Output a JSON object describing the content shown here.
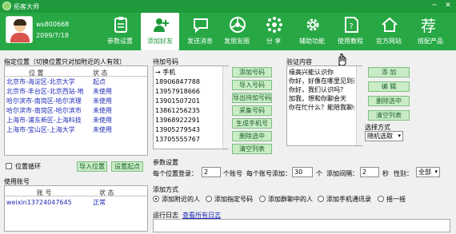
{
  "window": {
    "title": "拓客大师",
    "controls": [
      "─",
      "✕"
    ]
  },
  "account": {
    "name": "ws800668",
    "date": "2099/7/18"
  },
  "nav": [
    {
      "label": "参数设置",
      "icon": "clipboard-icon"
    },
    {
      "label": "添加好友",
      "icon": "add-user-icon"
    },
    {
      "label": "发送消息",
      "icon": "chat-icon"
    },
    {
      "label": "发朋友圈",
      "icon": "moments-icon"
    },
    {
      "label": "分  享",
      "icon": "share-icon"
    },
    {
      "label": "辅助功能",
      "icon": "gear-icon"
    },
    {
      "label": "使用教程",
      "icon": "help-icon"
    },
    {
      "label": "官方网站",
      "icon": "home-icon"
    },
    {
      "label": "搭配产品",
      "icon": "recommend-icon"
    }
  ],
  "nav_recommend_glyph": "荐",
  "location": {
    "title": "指定位置（切换位置只对加附近的人有效）",
    "headers": [
      "位    置",
      "状    态"
    ],
    "rows": [
      {
        "place": "北京市-海淀区-北京大学",
        "status": "起点"
      },
      {
        "place": "北京市-丰台区-北京西站-地",
        "status": "未使用"
      },
      {
        "place": "哈尔滨市-南岗区-哈尔滨理",
        "status": "未使用"
      },
      {
        "place": "哈尔滨市-南岗区-哈尔滨市",
        "status": "未使用"
      },
      {
        "place": "上海市-浦东新区-上海科技",
        "status": "未使用"
      },
      {
        "place": "上海市-宝山区-上海大学",
        "status": "未使用"
      }
    ],
    "loop_label": "位置循环",
    "import_label": "导入位置",
    "set_start_label": "设置起点"
  },
  "accounts_used": {
    "title": "使用账号",
    "headers": [
      "账    号",
      "状    态"
    ],
    "rows": [
      {
        "account": "weixin13724047645",
        "status": "正常"
      }
    ]
  },
  "pending": {
    "title": "待加号码",
    "items": [
      "→ 手机",
      "18906847788",
      "13957918666",
      "13901507201",
      "13861256235",
      "13968922291",
      "13905279543",
      "13705555767"
    ],
    "buttons": [
      "添加号码",
      "导入号码",
      "导出待加号码",
      "采集号码",
      "生成手机号",
      "删除选中",
      "清空列表"
    ]
  },
  "verify": {
    "title": "验证内容",
    "items": [
      "缘高兴能认识你",
      "你好，好像在哪里见到过你",
      "你好，我们认识吗？",
      "加我，想和你聊会天",
      "你在忙什么？能陪我聊会吗"
    ],
    "buttons": [
      "添  加",
      "编  辑",
      "删除选中",
      "清空列表"
    ],
    "mode_label": "选择方式",
    "mode_value": "随机选取"
  },
  "params": {
    "title": "参数设置",
    "per_location_label": "每个位置登录：",
    "per_location_value": "2",
    "per_location_unit": "个账号",
    "per_account_label": "每个账号添加：",
    "per_account_value": "30",
    "per_account_unit": "个",
    "interval_label": "添加间隔：",
    "interval_value": "2",
    "interval_unit": "秒",
    "gender_label": "性别：",
    "gender_value": "全部"
  },
  "add_mode": {
    "title": "添加方式",
    "options": [
      "添加附近的人",
      "添加指定号码",
      "添加群聊中的人",
      "添加手机通讯录",
      "摇一摇"
    ],
    "selected": 0
  },
  "log": {
    "title": "运行日志",
    "link": "查看所有日志"
  }
}
